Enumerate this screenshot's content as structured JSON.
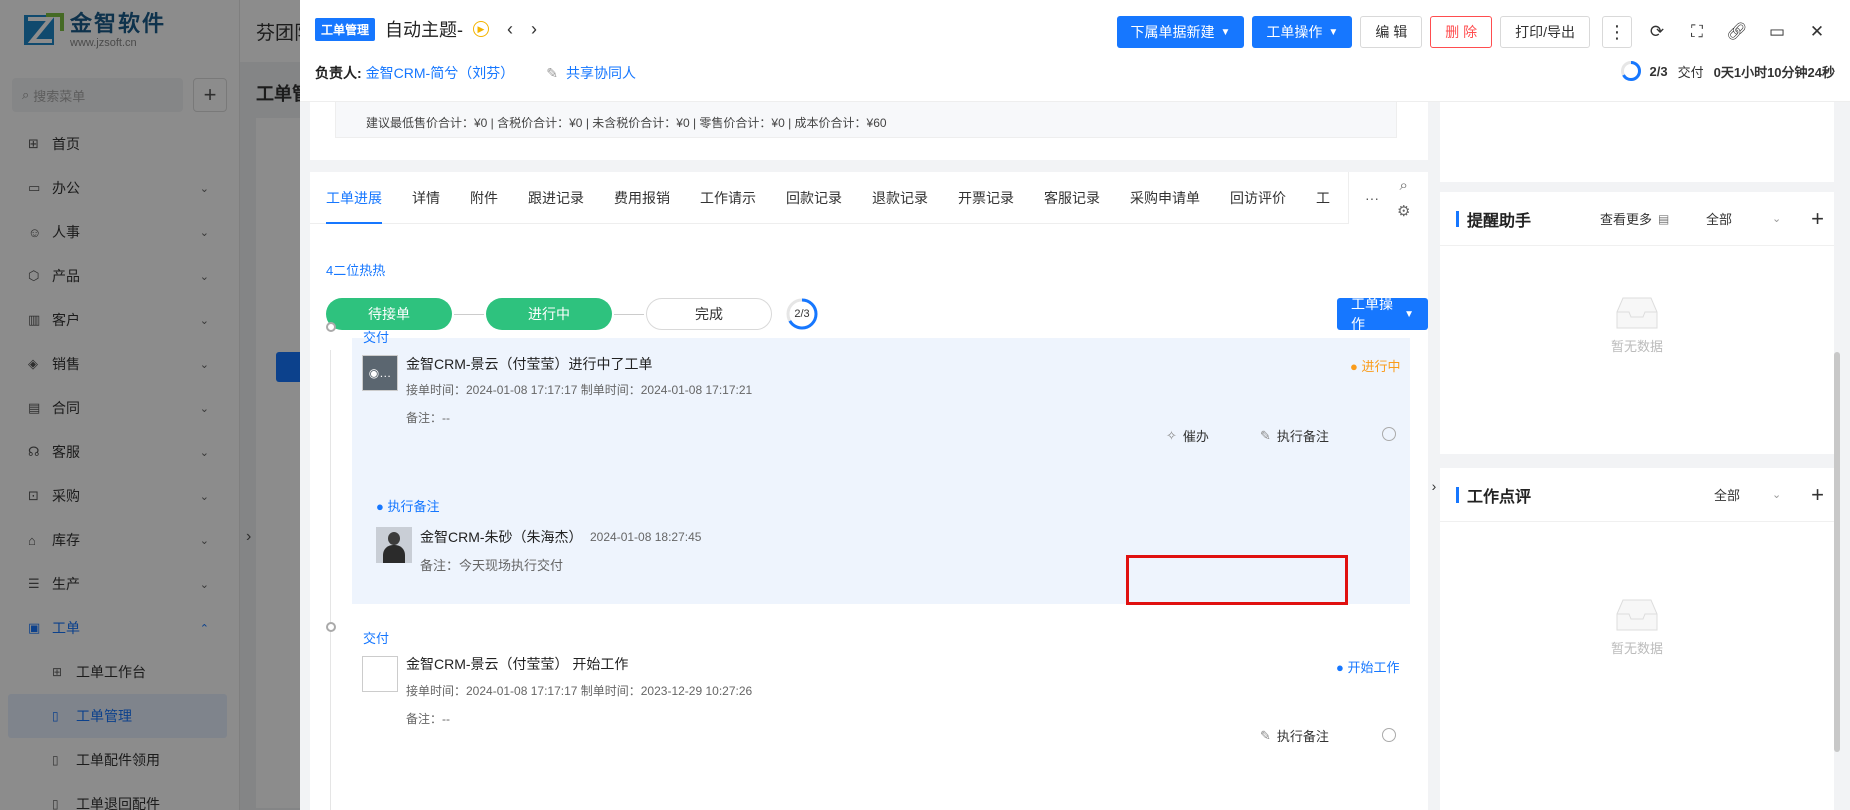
{
  "sidebar": {
    "logo": {
      "name": "金智软件",
      "url": "www.jzsoft.cn"
    },
    "search_placeholder": "搜索菜单",
    "items": [
      {
        "label": "首页",
        "icon": "grid-icon"
      },
      {
        "label": "办公",
        "icon": "monitor-icon",
        "arrow": "⌄"
      },
      {
        "label": "人事",
        "icon": "people-icon",
        "arrow": "⌄"
      },
      {
        "label": "产品",
        "icon": "box-icon",
        "arrow": "⌄"
      },
      {
        "label": "客户",
        "icon": "chart-icon",
        "arrow": "⌄"
      },
      {
        "label": "销售",
        "icon": "sales-icon",
        "arrow": "⌄"
      },
      {
        "label": "合同",
        "icon": "contract-icon",
        "arrow": "⌄"
      },
      {
        "label": "客服",
        "icon": "headset-icon",
        "arrow": "⌄"
      },
      {
        "label": "采购",
        "icon": "cart-icon",
        "arrow": "⌄"
      },
      {
        "label": "库存",
        "icon": "warehouse-icon",
        "arrow": "⌄"
      },
      {
        "label": "生产",
        "icon": "production-icon",
        "arrow": "⌄"
      },
      {
        "label": "工单",
        "icon": "ticket-icon",
        "arrow": "⌃"
      }
    ],
    "sub_items": [
      {
        "label": "工单工作台"
      },
      {
        "label": "工单管理"
      },
      {
        "label": "工单配件领用"
      },
      {
        "label": "工单退回配件"
      }
    ]
  },
  "background": {
    "header_text": "芬团队",
    "page_title": "工单管"
  },
  "drawer": {
    "tag": "工单管理",
    "title": "自动主题-",
    "owner_label": "负责人:",
    "owner": "金智CRM-简兮（刘芬）",
    "share_label": "共享协同人",
    "actions": {
      "sub_new": "下属单据新建",
      "ops": "工单操作",
      "edit": "编 辑",
      "delete": "删 除",
      "print": "打印/导出"
    },
    "progress": {
      "fraction": "2/3",
      "stage": "交付",
      "duration": "0天1小时10分钟24秒",
      "ratio": 0.6667
    },
    "summary": "建议最低售价合计：¥0 |  含税价合计：¥0 |  未含税价合计：¥0 |  零售价合计：¥0 |  成本价合计：¥60",
    "tabs": [
      "工单进展",
      "详情",
      "附件",
      "跟进记录",
      "费用报销",
      "工作请示",
      "回款记录",
      "退款记录",
      "开票记录",
      "客服记录",
      "采购申请单",
      "回访评价",
      "工"
    ],
    "tab_more": "···",
    "section_link": "4二位热热",
    "steps": [
      {
        "label": "待接单",
        "state": "done"
      },
      {
        "label": "进行中",
        "state": "done"
      },
      {
        "label": "完成",
        "state": "todo"
      }
    ],
    "step_ring": "2/3",
    "ops_button": "工单操作",
    "entries": [
      {
        "stage": "交付",
        "name": "金智CRM-景云（付莹莹）进行中了工单",
        "meta": "接单时间：2024-01-08 17:17:17   制单时间：2024-01-08 17:17:21",
        "note": "备注：--",
        "status": "进行中",
        "action1": "催办",
        "action2": "执行备注",
        "sub_title": "执行备注",
        "sub_name": "金智CRM-朱砂（朱海杰）",
        "sub_time": "2024-01-08 18:27:45",
        "sub_note": "备注：今天现场执行交付"
      },
      {
        "stage": "交付",
        "name": "金智CRM-景云（付莹莹） 开始工作",
        "meta": "接单时间：2024-01-08 17:17:17   制单时间：2023-12-29 10:27:26",
        "note": "备注：--",
        "status": "开始工作",
        "action2": "执行备注"
      }
    ]
  },
  "right": {
    "reminder": {
      "title": "提醒助手",
      "more": "查看更多",
      "filter": "全部",
      "empty": "暂无数据"
    },
    "review": {
      "title": "工作点评",
      "filter": "全部",
      "empty": "暂无数据"
    }
  },
  "colors": {
    "primary": "#1677ff",
    "success": "#2ec27e",
    "warning": "#fa9c1b",
    "danger": "#ff4d4f"
  }
}
